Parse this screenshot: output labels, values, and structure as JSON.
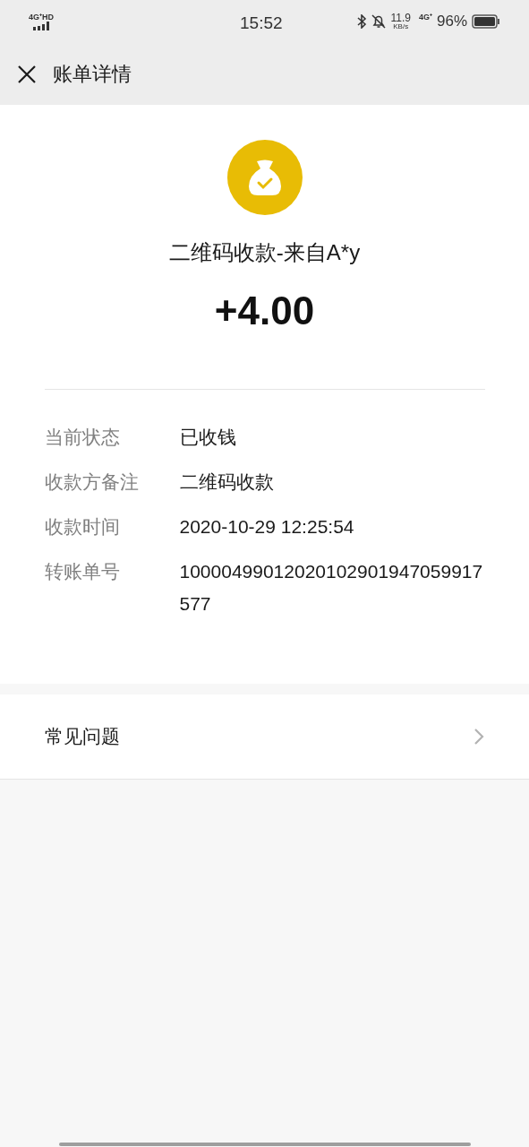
{
  "status_bar": {
    "network": "4G⁺HD",
    "time": "15:52",
    "speed": "11.9",
    "speed_unit": "KB/s",
    "network_right": "4G⁺",
    "battery": "96%"
  },
  "header": {
    "title": "账单详情"
  },
  "summary": {
    "title": "二维码收款-来自A*y",
    "amount": "+4.00"
  },
  "details": [
    {
      "label": "当前状态",
      "value": "已收钱"
    },
    {
      "label": "收款方备注",
      "value": "二维码收款"
    },
    {
      "label": "收款时间",
      "value": "2020-10-29 12:25:54"
    },
    {
      "label": "转账单号",
      "value": "10000499012020102901947059917577"
    }
  ],
  "links": [
    {
      "label": "常见问题"
    }
  ]
}
